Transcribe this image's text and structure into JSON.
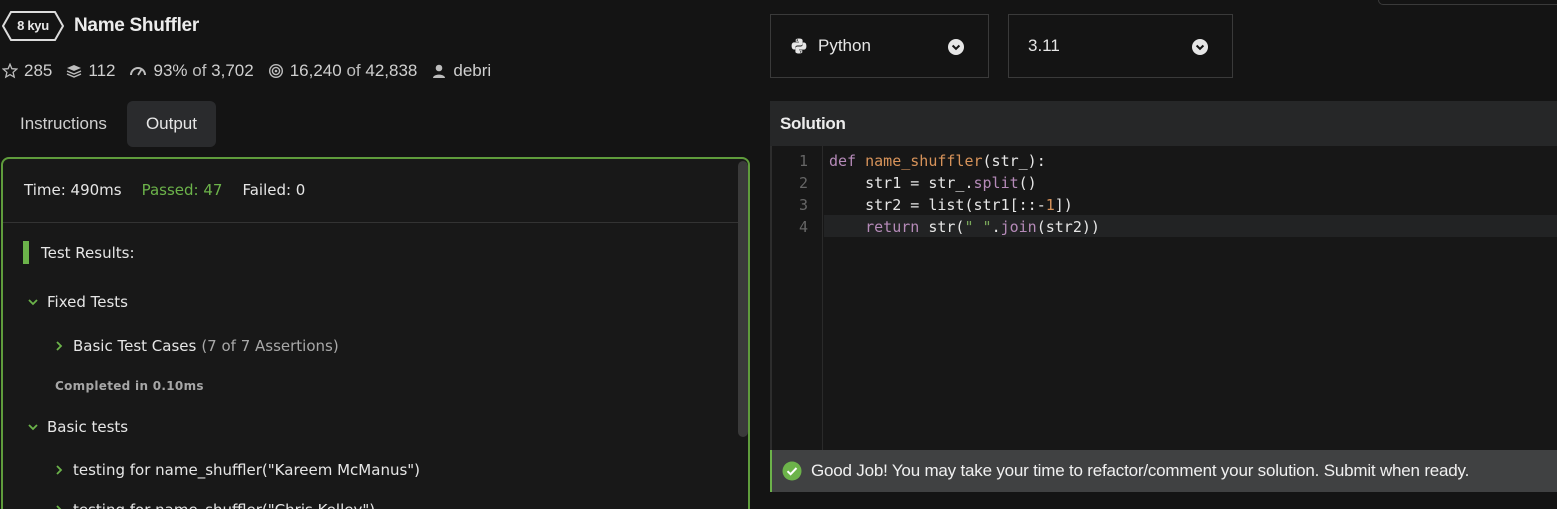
{
  "kata": {
    "rank": "8 kyu",
    "title": "Name Shuffler"
  },
  "stats": {
    "stars": "285",
    "collections": "112",
    "satisfaction_pct": "93%",
    "satisfaction_of": "of",
    "satisfaction_total": "3,702",
    "completed": "16,240",
    "completed_of": "of",
    "completed_total": "42,838",
    "author": "debri"
  },
  "tabs": [
    {
      "label": "Instructions",
      "active": false
    },
    {
      "label": "Output",
      "active": true
    }
  ],
  "output": {
    "time": "Time: 490ms",
    "passed": "Passed: 47",
    "failed": "Failed: 0",
    "results_heading": "Test Results:",
    "groups": [
      {
        "label": "Fixed Tests"
      },
      {
        "label": "Basic tests"
      }
    ],
    "basic_case_label": "Basic Test Cases",
    "basic_case_count": "(7 of 7 Assertions)",
    "completed_in": "Completed in 0.10ms",
    "test_item_1": "testing for name_shuffler(\"Kareem McManus\")",
    "test_item_2": "testing for name_shuffler(\"Chris Kelley\")"
  },
  "editor": {
    "language": "Python",
    "version": "3.11",
    "panel_title": "Solution",
    "line_numbers": [
      "1",
      "2",
      "3",
      "4"
    ],
    "code": {
      "l1_kw": "def",
      "l1_fn": "name_shuffler",
      "l1_rest": "(str_):",
      "l2_a": "    str1 = str_.",
      "l2_fn": "split",
      "l2_b": "()",
      "l3_a": "    str2 = list(str1[::-",
      "l3_num": "1",
      "l3_b": "])",
      "l4_kw": "    return",
      "l4_a": " str(",
      "l4_str": "\" \"",
      "l4_b": ".",
      "l4_fn": "join",
      "l4_c": "(str2))"
    }
  },
  "success_message": "Good Job! You may take your time to refactor/comment your solution. Submit when ready.",
  "colors": {
    "accent_green": "#6cb34a",
    "background": "#141414"
  }
}
